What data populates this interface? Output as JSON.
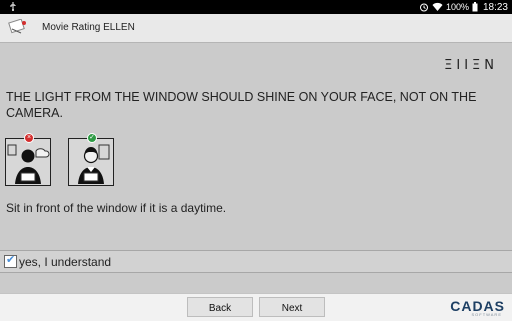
{
  "status_bar": {
    "battery_percent": "100%",
    "time": "18:23"
  },
  "app": {
    "title": "Movie Rating ELLEN",
    "brand": "ΞIIΞN"
  },
  "content": {
    "instruction": "THE LIGHT FROM THE WINDOW SHOULD SHINE ON YOUR FACE, NOT ON THE CAMERA.",
    "advice": "Sit in front of the window if it is a daytime.",
    "confirm_label": "yes, I understand",
    "confirm_checked": true
  },
  "buttons": {
    "back": "Back",
    "next": "Next"
  },
  "footer": {
    "logo_text": "CADAS",
    "logo_subtitle": "SOFTWARE"
  },
  "colors": {
    "background": "#cbcbcb",
    "logo": "#1d3f63",
    "check": "#4a8fd8",
    "wrong": "#d32f2f",
    "correct": "#2e9b45"
  }
}
